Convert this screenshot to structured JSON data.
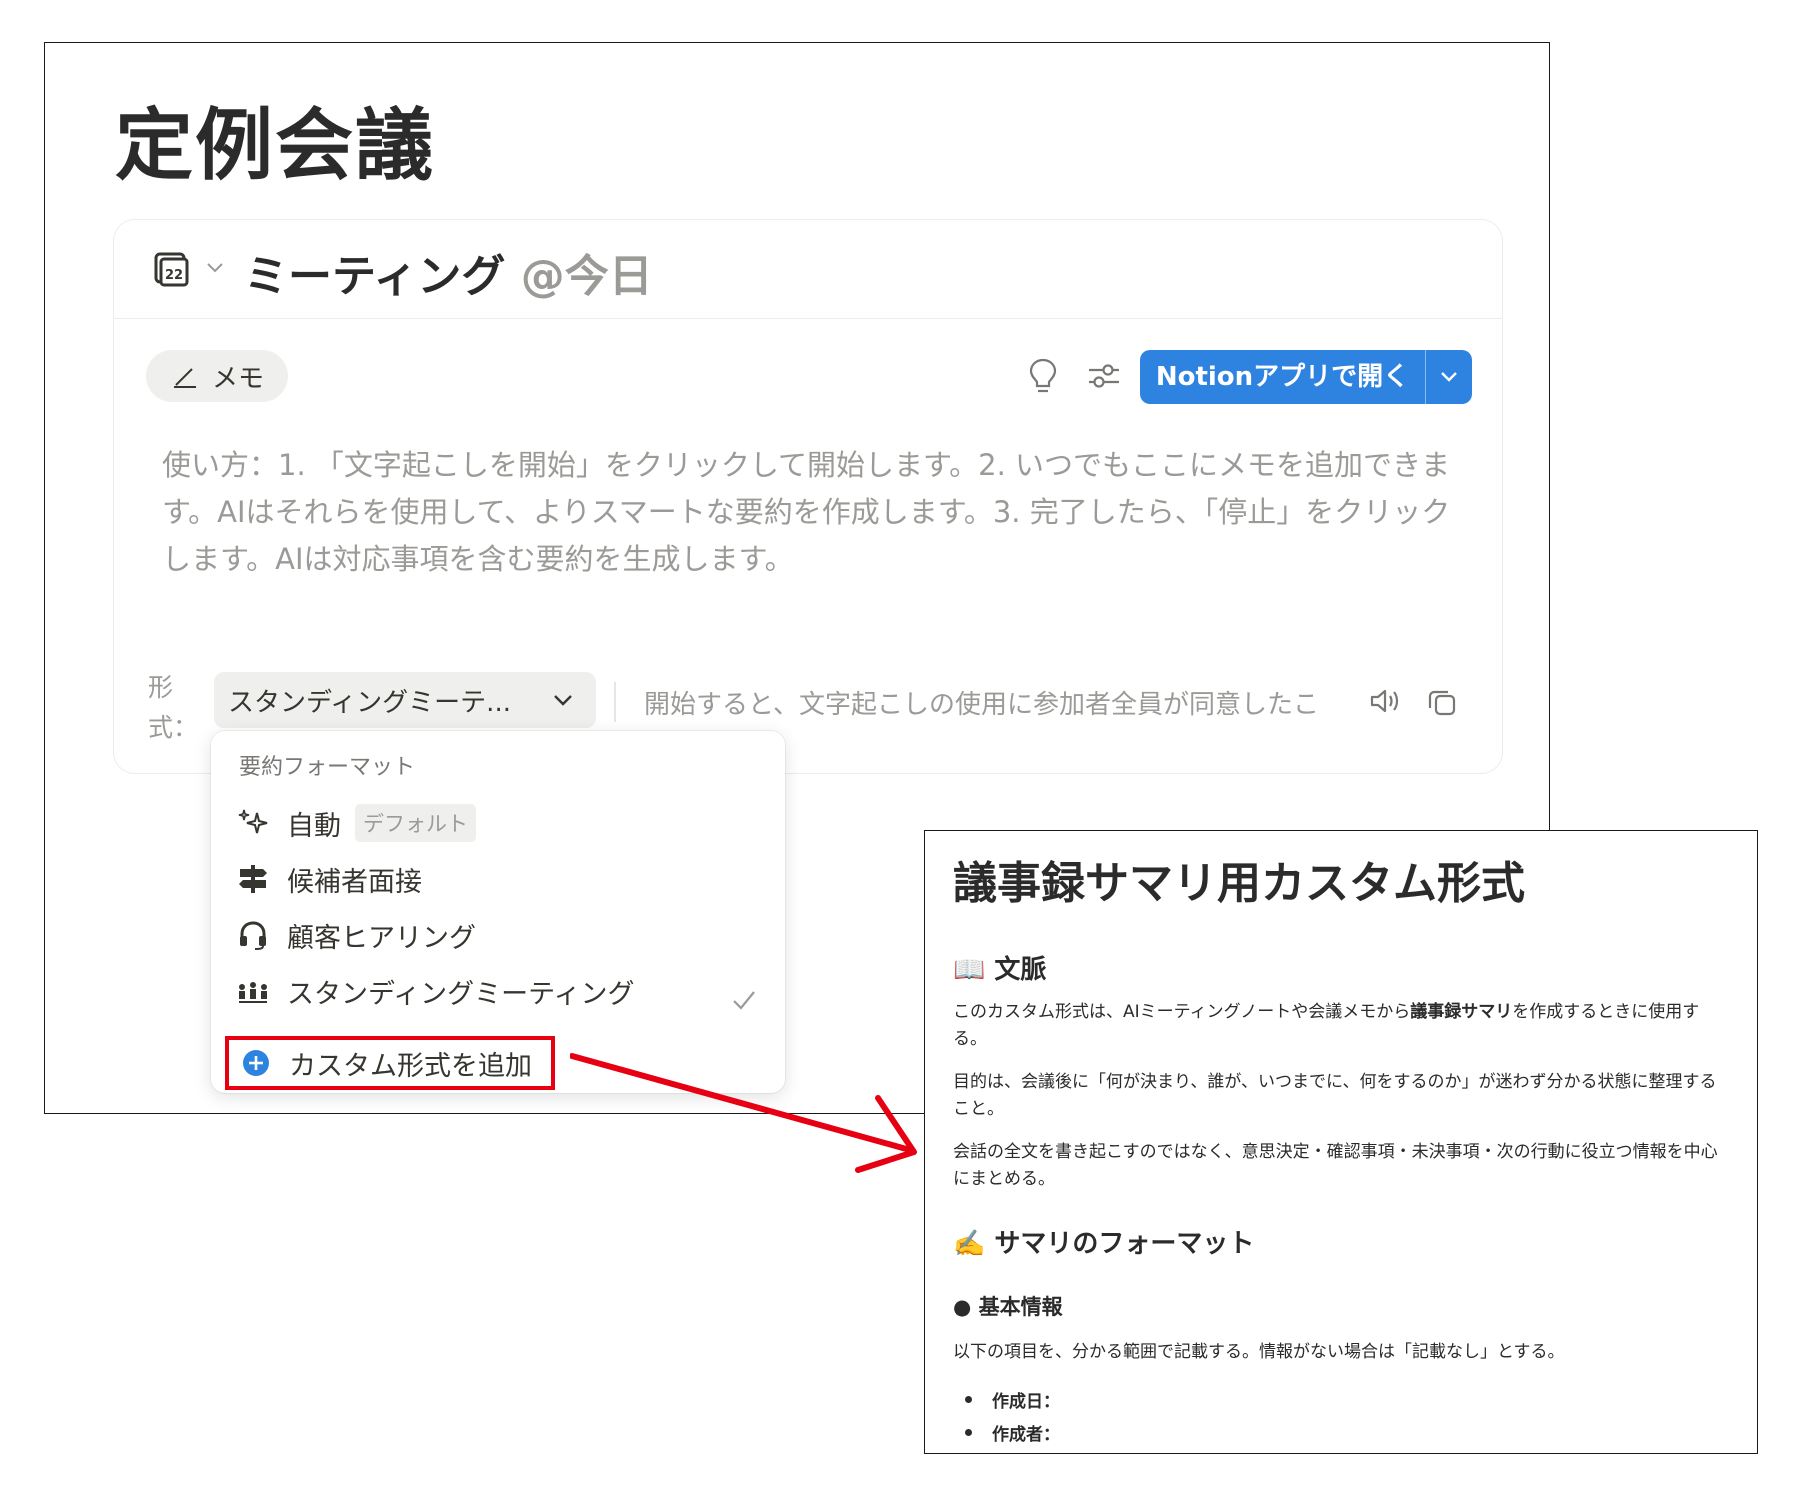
{
  "page": {
    "title": "定例会議"
  },
  "meeting": {
    "title": "ミーティング",
    "date": "@今日",
    "memo_label": "メモ",
    "open_button_label": "Notionアプリで開く",
    "instructions": "使い方：1. 「文字起こしを開始」をクリックして開始します。2. いつでもここにメモを追加できます。AIはそれらを使用して、よりスマートな要約を作成します。3. 完了したら、「停止」をクリックします。AIは対応事項を含む要約を生成します。",
    "format_label": "形式：",
    "format_selected": "スタンディングミーテ...",
    "consent_text": "開始すると、文字起こしの使用に参加者全員が同意したこ",
    "calendar_day": "22"
  },
  "dropdown": {
    "header": "要約フォーマット",
    "items": [
      {
        "label": "自動",
        "badge": "デフォルト",
        "icon": "sparkles-icon"
      },
      {
        "label": "候補者面接",
        "icon": "signpost-icon"
      },
      {
        "label": "顧客ヒアリング",
        "icon": "headset-icon"
      },
      {
        "label": "スタンディングミーティング",
        "icon": "people-icon",
        "selected": true
      }
    ],
    "add_custom_label": "カスタム形式を追加"
  },
  "doc": {
    "title": "議事録サマリ用カスタム形式",
    "context_heading": "📖 文脈",
    "context_p1_a": "このカスタム形式は、AIミーティングノートや会議メモから",
    "context_p1_bold": "議事録サマリ",
    "context_p1_b": "を作成するときに使用する。",
    "context_p2": "目的は、会議後に「何が決まり、誰が、いつまでに、何をするのか」が迷わず分かる状態に整理すること。",
    "context_p3": "会話の全文を書き起こすのではなく、意思決定・確認事項・未決事項・次の行動に役立つ情報を中心にまとめる。",
    "format_heading": "✍️ サマリのフォーマット",
    "basic_heading": "● 基本情報",
    "basic_p": "以下の項目を、分かる範囲で記載する。情報がない場合は「記載なし」とする。",
    "list": [
      "作成日：",
      "作成者："
    ]
  },
  "colors": {
    "accent": "#2f83e0",
    "highlight": "#e60012",
    "muted_text": "#9b9a97"
  }
}
